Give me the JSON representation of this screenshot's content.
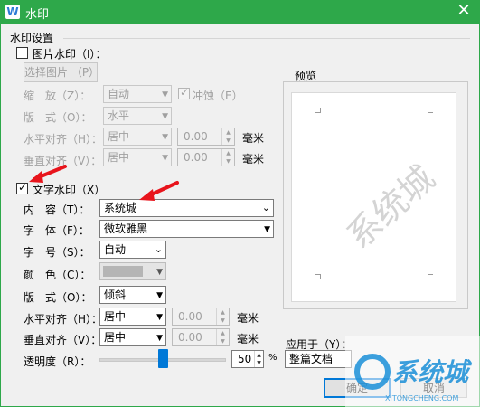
{
  "window": {
    "title": "水印",
    "app_icon": "W"
  },
  "group": {
    "title": "水印设置"
  },
  "picture": {
    "checkbox_label": "图片水印（I）：",
    "select_button": "选择图片 （P）",
    "scale_label": "缩　放（Z）：",
    "scale_value": "自动",
    "washout_label": "冲蚀（E）",
    "layout_label": "版　式（O）：",
    "layout_value": "水平",
    "halign_label": "水平对齐（H）：",
    "halign_value": "居中",
    "halign_offset": "0.00",
    "valign_label": "垂直对齐（V）：",
    "valign_value": "居中",
    "valign_offset": "0.00",
    "unit": "毫米"
  },
  "text": {
    "checkbox_label": "文字水印（X）",
    "content_label": "内　容（T）：",
    "content_value": "系统城",
    "font_label": "字　体（F）：",
    "font_value": "微软雅黑",
    "size_label": "字　号（S）：",
    "size_value": "自动",
    "color_label": "颜　色（C）：",
    "layout_label": "版　式（O）：",
    "layout_value": "倾斜",
    "halign_label": "水平对齐（H）：",
    "halign_value": "居中",
    "halign_offset": "0.00",
    "valign_label": "垂直对齐（V）：",
    "valign_value": "居中",
    "valign_offset": "0.00",
    "unit": "毫米",
    "transparency_label": "透明度（R）：",
    "transparency_value": "50",
    "percent": "%"
  },
  "preview": {
    "label": "预览",
    "watermark_text": "系统城"
  },
  "apply": {
    "label": "应用于（Y）：",
    "value": "整篇文档"
  },
  "buttons": {
    "ok": "确定",
    "cancel": "取消"
  },
  "logo": {
    "text": "系统城",
    "url_text": "XITONGCHENG.COM"
  },
  "colors": {
    "title_bar": "#2ea84a",
    "accent": "#0078d7",
    "annotation_arrow": "#e8141c"
  }
}
